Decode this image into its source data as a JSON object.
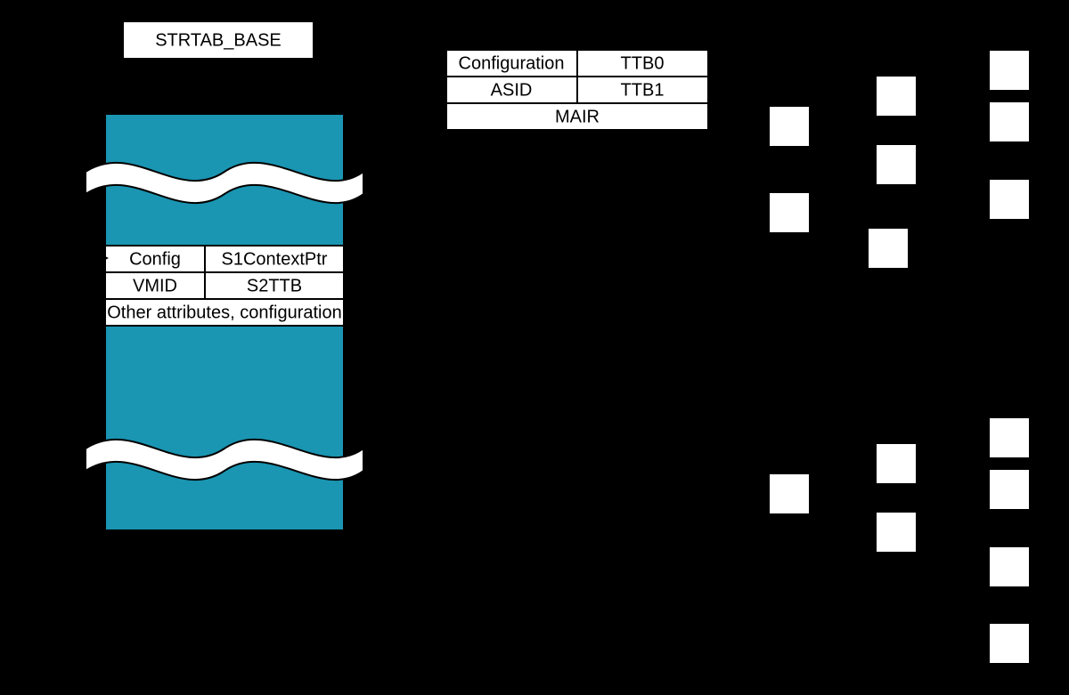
{
  "register_label": "STRTAB_BASE",
  "stream_table": {
    "color": "#1A95B2",
    "ste": {
      "r0c0": "Config",
      "r0c1": "S1ContextPtr",
      "r1c0": "VMID",
      "r1c1": "S2TTB",
      "r2": "Other attributes, configuration"
    }
  },
  "context": {
    "r0c0": "Configuration",
    "r0c1": "TTB0",
    "r1c0": "ASID",
    "r1c1": "TTB1",
    "r2": "MAIR"
  }
}
